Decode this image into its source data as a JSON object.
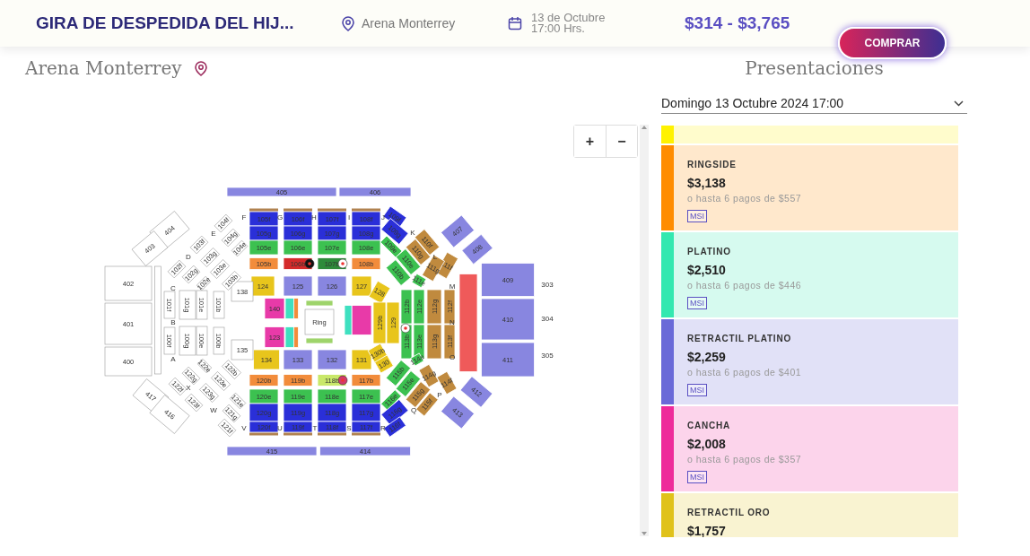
{
  "header": {
    "title": "GIRA DE DESPEDIDA DEL HIJ...",
    "venue": "Arena Monterrey",
    "date_line_1": "13 de Octubre",
    "date_line_2": "17:00 Hrs.",
    "price_range": "$314 - $3,765",
    "buy_button": "COMPRAR"
  },
  "venue_heading": "Arena Monterrey",
  "presentations_heading": "Presentaciones",
  "date_select": {
    "value": "Domingo 13 Octubre 2024 17:00"
  },
  "zoom_controls": [
    "+",
    "−"
  ],
  "seat_map": {
    "sections": [
      {
        "label": "405",
        "color": "#8886e0"
      },
      {
        "label": "406",
        "color": "#8886e0"
      },
      {
        "label": "105f",
        "color": "#2a2fd8"
      },
      {
        "label": "106f",
        "color": "#2a2fd8"
      },
      {
        "label": "107f",
        "color": "#2a2fd8"
      },
      {
        "label": "108f",
        "color": "#2a2fd8"
      },
      {
        "label": "105g",
        "color": "#2a2fd8"
      },
      {
        "label": "106g",
        "color": "#2a2fd8"
      },
      {
        "label": "107g",
        "color": "#2a2fd8"
      },
      {
        "label": "108g",
        "color": "#2a2fd8"
      },
      {
        "label": "105e",
        "color": "#3cc150"
      },
      {
        "label": "106e",
        "color": "#3cc150"
      },
      {
        "label": "107e",
        "color": "#3cc150"
      },
      {
        "label": "108e",
        "color": "#3cc150"
      },
      {
        "label": "105b",
        "color": "#f28c3b"
      },
      {
        "label": "106b",
        "color": "#d42a2a"
      },
      {
        "label": "107b",
        "color": "#2e8b3a"
      },
      {
        "label": "108b",
        "color": "#f28c3b"
      },
      {
        "label": "124",
        "color": "#e8c51c"
      },
      {
        "label": "125",
        "color": "#8886e0"
      },
      {
        "label": "126",
        "color": "#8886e0"
      },
      {
        "label": "127",
        "color": "#e8c51c"
      },
      {
        "label": "138",
        "color": "#ffffff"
      },
      {
        "label": "140",
        "color": "#e83aa8"
      },
      {
        "label": "123",
        "color": "#e83aa8"
      },
      {
        "label": "Ring",
        "color": "#ffffff"
      },
      {
        "color": "#3ee0c0"
      },
      {
        "color": "#f28c3b"
      },
      {
        "color": "#3ee0c0"
      },
      {
        "color": "#f28c3b"
      },
      {
        "color": "#e83aa8"
      },
      {
        "color": "#3ee0c0"
      },
      {
        "color": "#9ed46b"
      },
      {
        "color": "#9ed46b"
      },
      {
        "label": "134",
        "color": "#e8c51c"
      },
      {
        "label": "133",
        "color": "#8886e0"
      },
      {
        "label": "132",
        "color": "#8886e0"
      },
      {
        "label": "131",
        "color": "#e8c51c"
      },
      {
        "label": "135",
        "color": "#ffffff"
      },
      {
        "label": "120b",
        "color": "#f28c3b"
      },
      {
        "label": "119b",
        "color": "#f28c3b"
      },
      {
        "label": "118b",
        "color": "#c9e86a"
      },
      {
        "label": "117b",
        "color": "#f28c3b"
      },
      {
        "label": "120e",
        "color": "#3cc150"
      },
      {
        "label": "119e",
        "color": "#3cc150"
      },
      {
        "label": "118e",
        "color": "#3cc150"
      },
      {
        "label": "117e",
        "color": "#3cc150"
      },
      {
        "label": "120g",
        "color": "#2a2fd8"
      },
      {
        "label": "119g",
        "color": "#2a2fd8"
      },
      {
        "label": "118g",
        "color": "#2a2fd8"
      },
      {
        "label": "117g",
        "color": "#2a2fd8"
      },
      {
        "label": "120f",
        "color": "#2a2fd8"
      },
      {
        "label": "119f",
        "color": "#2a2fd8"
      },
      {
        "label": "118f",
        "color": "#2a2fd8"
      },
      {
        "label": "117f",
        "color": "#2a2fd8"
      },
      {
        "label": "109f",
        "color": "#2a2fd8"
      },
      {
        "label": "109g",
        "color": "#2a2fd8"
      },
      {
        "label": "109e",
        "color": "#3cc150"
      },
      {
        "label": "110f",
        "color": "#c08a3e"
      },
      {
        "label": "110g",
        "color": "#c08a3e"
      },
      {
        "label": "110e",
        "color": "#3cc150"
      },
      {
        "label": "110b",
        "color": "#3cc150"
      },
      {
        "label": "111f",
        "color": "#c08a3e"
      },
      {
        "label": "111g",
        "color": "#c08a3e"
      },
      {
        "label": "111e",
        "color": "#3cc150"
      },
      {
        "label": "128",
        "color": "#e8c51c"
      },
      {
        "label": "129b",
        "color": "#e8c51c"
      },
      {
        "label": "129",
        "color": "#e8c51c"
      },
      {
        "label": "130b",
        "color": "#e8c51c"
      },
      {
        "label": "130",
        "color": "#e8c51c"
      },
      {
        "label": "112b",
        "color": "#3cc150"
      },
      {
        "label": "112e",
        "color": "#3cc150"
      },
      {
        "label": "113b",
        "color": "#3cc150"
      },
      {
        "label": "113e",
        "color": "#3cc150"
      },
      {
        "label": "112g",
        "color": "#c08a3e"
      },
      {
        "label": "112f",
        "color": "#c08a3e"
      },
      {
        "label": "113g",
        "color": "#c08a3e"
      },
      {
        "label": "113f",
        "color": "#c08a3e"
      },
      {
        "color": "#ef5a5a"
      },
      {
        "label": "409",
        "color": "#8886e0"
      },
      {
        "label": "410",
        "color": "#8886e0"
      },
      {
        "label": "411",
        "color": "#8886e0"
      },
      {
        "label": "407",
        "color": "#8886e0"
      },
      {
        "label": "408",
        "color": "#8886e0"
      },
      {
        "label": "412",
        "color": "#8886e0"
      },
      {
        "label": "413",
        "color": "#8886e0"
      },
      {
        "label": "114e",
        "color": "#3cc150"
      },
      {
        "label": "114g",
        "color": "#c08a3e"
      },
      {
        "label": "114f",
        "color": "#c08a3e"
      },
      {
        "label": "115b",
        "color": "#3cc150"
      },
      {
        "label": "115e",
        "color": "#3cc150"
      },
      {
        "label": "115g",
        "color": "#c08a3e"
      },
      {
        "label": "115f",
        "color": "#c08a3e"
      },
      {
        "label": "116e",
        "color": "#3cc150"
      },
      {
        "label": "116g",
        "color": "#2a2fd8"
      },
      {
        "label": "116f",
        "color": "#2a2fd8"
      },
      {
        "label": "415",
        "color": "#8886e0"
      },
      {
        "label": "414",
        "color": "#8886e0"
      },
      {
        "label": "404",
        "color": "#ffffff"
      },
      {
        "label": "403",
        "color": "#ffffff"
      },
      {
        "label": "402",
        "color": "#ffffff"
      },
      {
        "label": "401",
        "color": "#ffffff"
      },
      {
        "label": "400",
        "color": "#ffffff"
      },
      {
        "label": "417",
        "color": "#ffffff"
      },
      {
        "label": "416",
        "color": "#ffffff"
      },
      {
        "color": "#ffffff"
      },
      {
        "label": "104f",
        "color": "#ffffff"
      },
      {
        "label": "104g",
        "color": "#ffffff"
      },
      {
        "label": "104e",
        "color": "#ffffff"
      },
      {
        "label": "103f",
        "color": "#ffffff"
      },
      {
        "label": "103g",
        "color": "#ffffff"
      },
      {
        "label": "103e",
        "color": "#ffffff"
      },
      {
        "label": "103b",
        "color": "#ffffff"
      },
      {
        "label": "102f",
        "color": "#ffffff"
      },
      {
        "label": "102g",
        "color": "#ffffff"
      },
      {
        "label": "102e",
        "color": "#ffffff"
      },
      {
        "label": "101f",
        "color": "#ffffff"
      },
      {
        "label": "101g",
        "color": "#ffffff"
      },
      {
        "label": "101e",
        "color": "#ffffff"
      },
      {
        "label": "101b",
        "color": "#ffffff"
      },
      {
        "label": "100f",
        "color": "#ffffff"
      },
      {
        "label": "100g",
        "color": "#ffffff"
      },
      {
        "label": "100e",
        "color": "#ffffff"
      },
      {
        "label": "100b",
        "color": "#ffffff"
      },
      {
        "label": "122e",
        "color": "#ffffff"
      },
      {
        "label": "122g",
        "color": "#ffffff"
      },
      {
        "label": "122f",
        "color": "#ffffff"
      },
      {
        "label": "122b",
        "color": "#ffffff"
      },
      {
        "label": "123e",
        "color": "#ffffff"
      },
      {
        "label": "123g",
        "color": "#ffffff"
      },
      {
        "label": "123f",
        "color": "#ffffff"
      },
      {
        "label": "121e",
        "color": "#ffffff"
      },
      {
        "label": "121g",
        "color": "#ffffff"
      },
      {
        "label": "121f",
        "color": "#ffffff"
      }
    ],
    "row_letters": [
      "F",
      "G",
      "H",
      "I",
      "J",
      "E",
      "K",
      "D",
      "L",
      "C",
      "M",
      "B",
      "N",
      "A",
      "O",
      "X",
      "P",
      "W",
      "Q",
      "V",
      "U",
      "T",
      "S",
      "R"
    ],
    "side_labels": [
      "303",
      "304",
      "305"
    ]
  },
  "price_tiers": [
    {
      "color": "#fff200"
    },
    {
      "name": "RINGSIDE",
      "price": "$3,138",
      "installments": "o hasta 6 pagos de $557",
      "msi": "MSI",
      "color": "#ff8c00"
    },
    {
      "name": "PLATINO",
      "price": "$2,510",
      "installments": "o hasta 6 pagos de $446",
      "msi": "MSI",
      "color": "#33e8b0"
    },
    {
      "name": "RETRACTIL PLATINO",
      "price": "$2,259",
      "installments": "o hasta 6 pagos de $401",
      "msi": "MSI",
      "color": "#6a6ad8"
    },
    {
      "name": "CANCHA",
      "price": "$2,008",
      "installments": "o hasta 6 pagos de $357",
      "msi": "MSI",
      "color": "#ee2a9a"
    },
    {
      "name": "RETRACTIL ORO",
      "price": "$1,757",
      "color": "#e0c21a"
    }
  ]
}
